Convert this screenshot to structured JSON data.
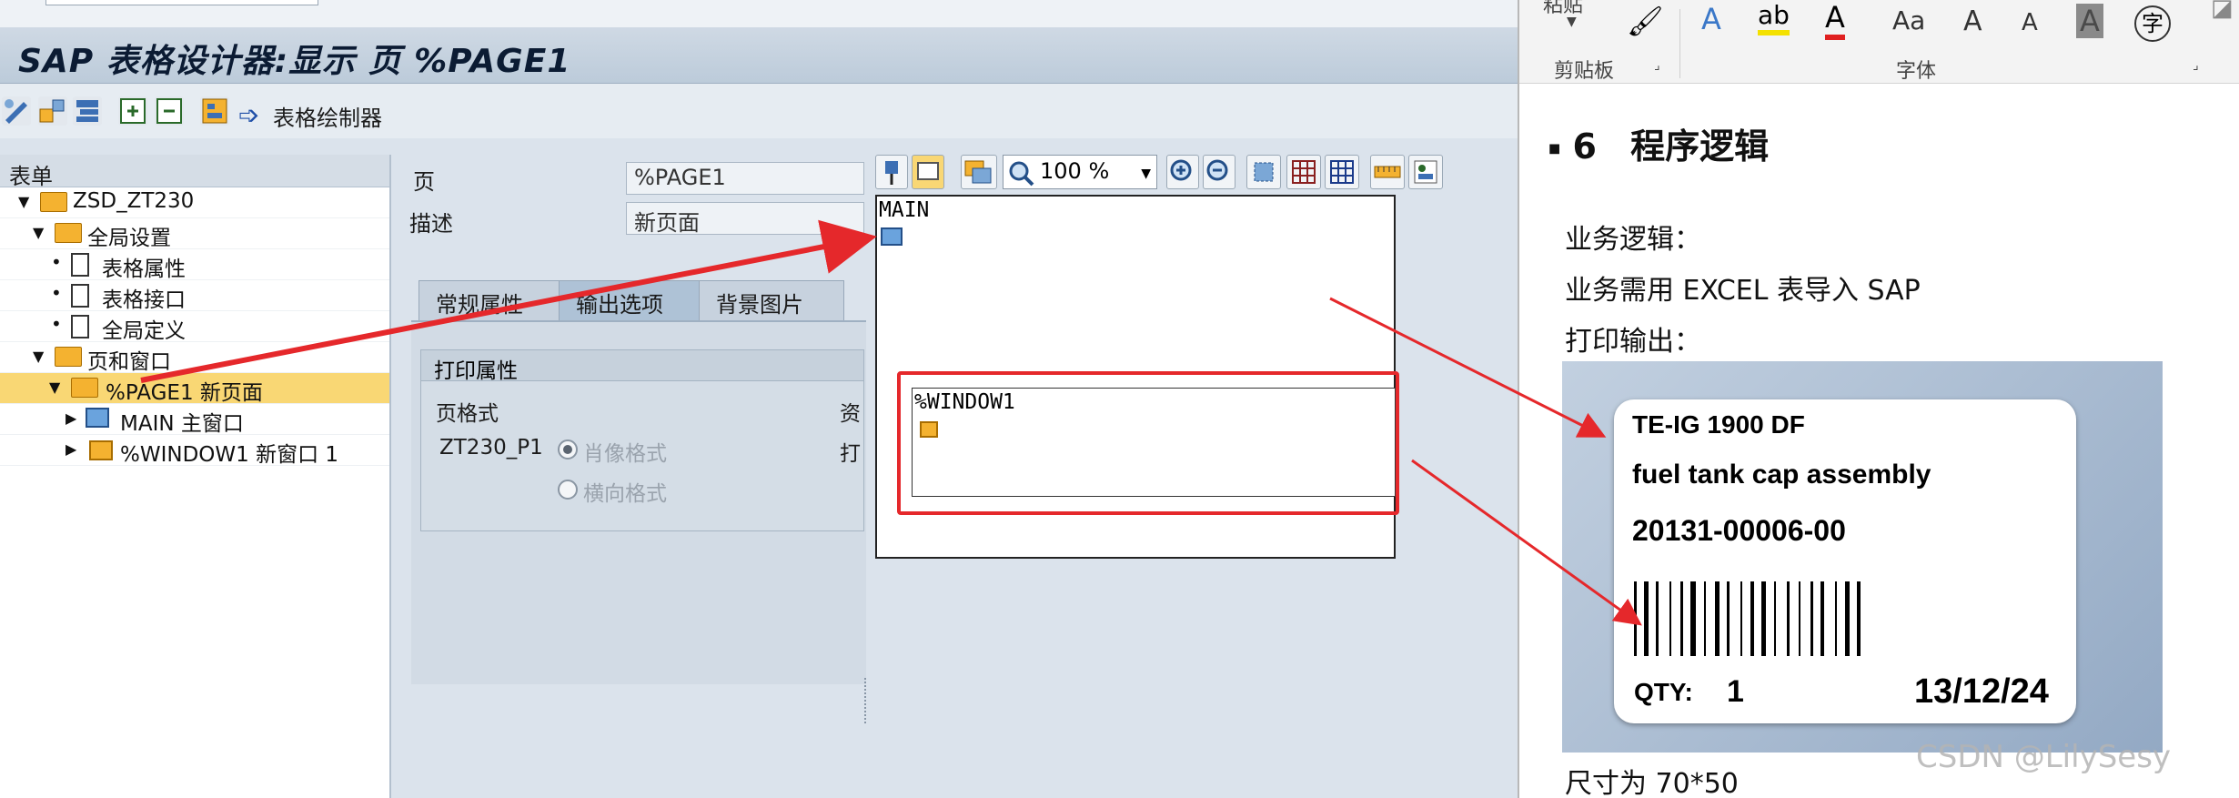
{
  "sap": {
    "title": "SAP 表格设计器:显示 页 %PAGE1",
    "toolbar": {
      "painter_label": "表格绘制器"
    },
    "tree": {
      "header": "表单",
      "items": [
        {
          "label": "ZSD_ZT230"
        },
        {
          "label": "全局设置"
        },
        {
          "label": "表格属性"
        },
        {
          "label": "表格接口"
        },
        {
          "label": "全局定义"
        },
        {
          "label": "页和窗口"
        },
        {
          "label": "%PAGE1 新页面"
        },
        {
          "label": "MAIN 主窗口"
        },
        {
          "label": "%WINDOW1 新窗口 1"
        }
      ]
    },
    "form": {
      "page_label": "页",
      "page_value": "%PAGE1",
      "desc_label": "描述",
      "desc_value": "新页面",
      "tabs": [
        "常规属性",
        "输出选项",
        "背景图片"
      ],
      "print_group": "打印属性",
      "page_format_label": "页格式",
      "page_format_value": "ZT230_P1",
      "portrait": "肖像格式",
      "landscape": "横向格式",
      "cut_resource": "资",
      "cut_print": "打"
    },
    "canvas": {
      "zoom": "100 %",
      "main_label": "MAIN",
      "window1_label": "%WINDOW1"
    }
  },
  "word": {
    "ribbon": {
      "paste": "粘贴",
      "clipboard": "剪贴板",
      "font": "字体",
      "aa": "Aa",
      "zi": "字"
    },
    "heading_num": "6",
    "heading_text": "程序逻辑",
    "lines": [
      "业务逻辑：",
      "业务需用 EXCEL 表导入 SAP",
      "打印输出：",
      "尺寸为 70*50"
    ],
    "label": {
      "line1": "TE-IG 1900 DF",
      "line2": "fuel tank cap assembly",
      "line3": "20131-00006-00",
      "qty_label": "QTY:",
      "qty_value": "1",
      "date": "13/12/24"
    },
    "watermark": "CSDN @LilySesy"
  },
  "colors": {
    "arrow_red": "#e5282b",
    "tree_selected": "#f9d774",
    "folder": "#f4b230"
  }
}
